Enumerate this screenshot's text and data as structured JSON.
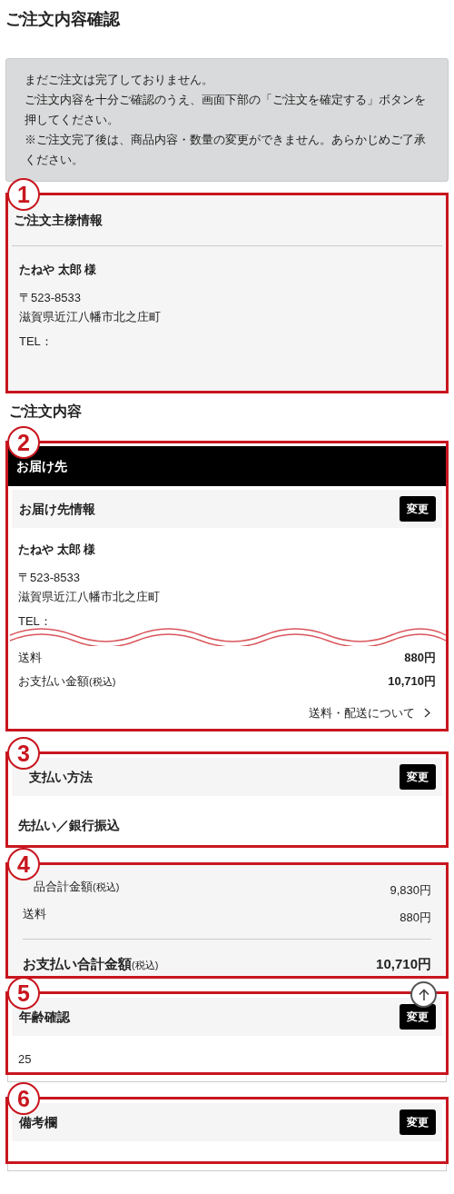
{
  "title": "ご注文内容確認",
  "notice": [
    "まだご注文は完了しておりません。",
    "ご注文内容を十分ご確認のうえ、画面下部の「ご注文を確定する」ボタンを押してください。",
    "※ご注文完了後は、商品内容・数量の変更ができません。あらかじめご了承ください。"
  ],
  "orderer": {
    "marker": "1",
    "heading": "ご注文主様情報",
    "name": "たねや 太郎 様",
    "postal": "〒523-8533",
    "address": "滋賀県近江八幡市北之庄町",
    "tel": "TEL："
  },
  "order_heading": "ご注文内容",
  "delivery": {
    "marker": "2",
    "banner": "お届け先",
    "header": "お届け先情報",
    "button": "変更",
    "name": "たねや 太郎 様",
    "postal": "〒523-8533",
    "address": "滋賀県近江八幡市北之庄町",
    "tel": "TEL：",
    "rows": [
      {
        "label": "送料",
        "value": "880円"
      },
      {
        "label": "お支払い金額",
        "note": "(税込)",
        "value": "10,710円"
      }
    ],
    "link": "送料・配送について"
  },
  "payment": {
    "marker": "3",
    "header": "支払い方法",
    "button": "変更",
    "value": "先払い／銀行振込"
  },
  "totals": {
    "marker": "4",
    "rows": [
      {
        "label": "品合計金額",
        "note": "(税込)",
        "value": "9,830円"
      },
      {
        "label": "送料",
        "value": "880円"
      }
    ],
    "total": {
      "label": "お支払い合計金額",
      "note": "(税込)",
      "value": "10,710円"
    }
  },
  "age": {
    "marker": "5",
    "header": "年齢確認",
    "button": "変更",
    "value": "25"
  },
  "remarks": {
    "marker": "6",
    "header": "備考欄",
    "button": "変更"
  }
}
